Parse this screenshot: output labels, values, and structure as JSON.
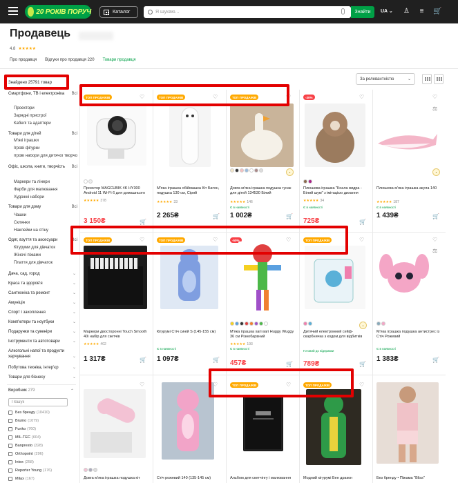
{
  "header": {
    "logo_text": "20 РОКІВ ПОРУЧ",
    "catalog_label": "Каталог",
    "search_placeholder": "Я шукаю...",
    "search_button": "Знайти",
    "lang": "UA",
    "brand_color": "#00a046",
    "header_bg": "#202020"
  },
  "page": {
    "title": "Продавець",
    "rating": "4.8",
    "stars": "★★★★★",
    "tabs": [
      "Про продавця",
      "Відгуки про продавця 220",
      "Товари продавця"
    ],
    "found": "Знайдено 25791 товар",
    "sort_label": "За релевантністю"
  },
  "sidebar": {
    "categories": [
      {
        "label": "Смартфони, ТВ і електроніка",
        "count": "Всі"
      },
      {
        "label": "Товари для дітей",
        "count": "Всі"
      },
      {
        "label": "Офіс, школа, книги, творчість",
        "count": "Всі"
      },
      {
        "label": "Товари для дому",
        "count": "Всі"
      },
      {
        "label": "Одяг, взуття та аксесуари",
        "count": "Всі"
      },
      {
        "label": "Дача, сад, город"
      },
      {
        "label": "Краса та здоров'я"
      },
      {
        "label": "Сантехніка та ремонт"
      },
      {
        "label": "Амуніція"
      },
      {
        "label": "Спорт і захоплення"
      },
      {
        "label": "Комп'ютери та ноутбуки"
      },
      {
        "label": "Подарунки та сувеніри"
      },
      {
        "label": "Інструменти та автотовари"
      },
      {
        "label": "Алкогольні напої та продукти харчування"
      },
      {
        "label": "Побутова техніка, інтер'єр"
      },
      {
        "label": "Товари для бізнесу"
      }
    ],
    "subs": {
      "electronics": [
        "Проектори",
        "Зарядні пристрої",
        "Кабелі та адаптери"
      ],
      "kids": [
        "М'які іграшки",
        "Ігрові фігурки",
        "Ігрові набори для дитячої творчості"
      ],
      "office": [
        "Маркери та лінери",
        "Фарби для малювання",
        "Художні набори"
      ],
      "home": [
        "Чашки",
        "Склянки",
        "Наклейки на стіну"
      ],
      "clothes": [
        "Кігуруми для дівчаток",
        "Жіночі піжами",
        "Плаття для дівчаток"
      ]
    },
    "maker_title": "Виробник",
    "maker_count": "279",
    "maker_search_placeholder": "Пошук",
    "makers": [
      {
        "name": "Без бренду",
        "count": "(10410)"
      },
      {
        "name": "Brumo",
        "count": "(1079)"
      },
      {
        "name": "Funko",
        "count": "(760)"
      },
      {
        "name": "MIL-TEC",
        "count": "(604)"
      },
      {
        "name": "Banpresto",
        "count": "(328)"
      },
      {
        "name": "Orthopoint",
        "count": "(296)"
      },
      {
        "name": "Intex",
        "count": "(258)"
      },
      {
        "name": "Reporter Young",
        "count": "(176)"
      },
      {
        "name": "Milax",
        "count": "(167)"
      }
    ]
  },
  "badges": {
    "top": "ТОП ПРОДАЖІВ",
    "sale30": "-30%",
    "sale50": "-50%"
  },
  "products": [
    {
      "name": "Проектор MAGCUBIK 4K HY300 Android 11 Wi-Fi 6 для домашнього",
      "reviews": "378",
      "price": "3 150₴",
      "old": "",
      "stock": "",
      "badge": "ТОП ПРОДАЖІВ"
    },
    {
      "name": "М'яка іграшка обіймашка Кіт Батон, подушка 130 см, Сірий",
      "reviews": "33",
      "price": "2 265₴",
      "old": "",
      "stock": "",
      "badge": "ТОП ПРОДАЖІВ"
    },
    {
      "name": "Довга м'яка іграшка подушка гусак для дітей 134530 Білий",
      "reviews": "146",
      "price": "1 002₴",
      "old": "",
      "stock": "Є в наявності",
      "badge": "ТОП ПРОДАЖІВ"
    },
    {
      "name": "Плюшева іграшка \"Коала видра - Білий шум\" з імітацією дихання",
      "reviews": "34",
      "price": "725₴",
      "old": "",
      "stock": "Є в наявності",
      "badge": "-30%"
    },
    {
      "name": "Плюшева м'яка іграшка акула 140",
      "reviews": "187",
      "price": "1 439₴",
      "old": "",
      "stock": "Є в наявності",
      "badge": ""
    },
    {
      "name": "Маркери двосторонні Touch Smooth 40i набір для скетчів",
      "reviews": "402",
      "price": "1 317₴",
      "old": "",
      "stock": "",
      "badge": "ТОП ПРОДАЖІВ"
    },
    {
      "name": "Кігурумі Стіч синій S (145-155 см)",
      "reviews": "",
      "price": "1 097₴",
      "old": "",
      "stock": "Є в наявності",
      "badge": "ТОП ПРОДАЖІВ"
    },
    {
      "name": "М'яка іграшка хагі вагі Huggy Wuggy 36 см Різнобарвний",
      "reviews": "193",
      "price": "457₴",
      "old": "",
      "stock": "Є в наявності",
      "badge": "-50%"
    },
    {
      "name": "Дитячий електронний сейф-скарбничка з кодом для відбитків",
      "reviews": "",
      "price": "789₴",
      "old": "",
      "stock": "Готовий до відправки",
      "badge": "ТОП ПРОДАЖІВ"
    },
    {
      "name": "М'яка іграшка подушка антистрес із Стіч Рожевий",
      "reviews": "",
      "price": "1 383₴",
      "old": "",
      "stock": "Є в наявності",
      "badge": ""
    },
    {
      "name": "Довга м'яка іграшка подушка кіт",
      "reviews": "",
      "price": "",
      "old": "",
      "stock": "",
      "badge": ""
    },
    {
      "name": "Стіч рожевий 140 (135-145 см)",
      "reviews": "",
      "price": "",
      "old": "",
      "stock": "",
      "badge": ""
    },
    {
      "name": "Альбом для скетчінгу і малювання",
      "reviews": "",
      "price": "",
      "old": "",
      "stock": "",
      "badge": "ТОП ПРОДАЖІВ"
    },
    {
      "name": "Модний кігурумі Бен дракон",
      "reviews": "",
      "price": "",
      "old": "",
      "stock": "",
      "badge": "ТОП ПРОДАЖІВ"
    },
    {
      "name": "Без бренду • Піжама \"Bliss\"",
      "reviews": "",
      "price": "",
      "old": "",
      "stock": "",
      "badge": ""
    }
  ]
}
